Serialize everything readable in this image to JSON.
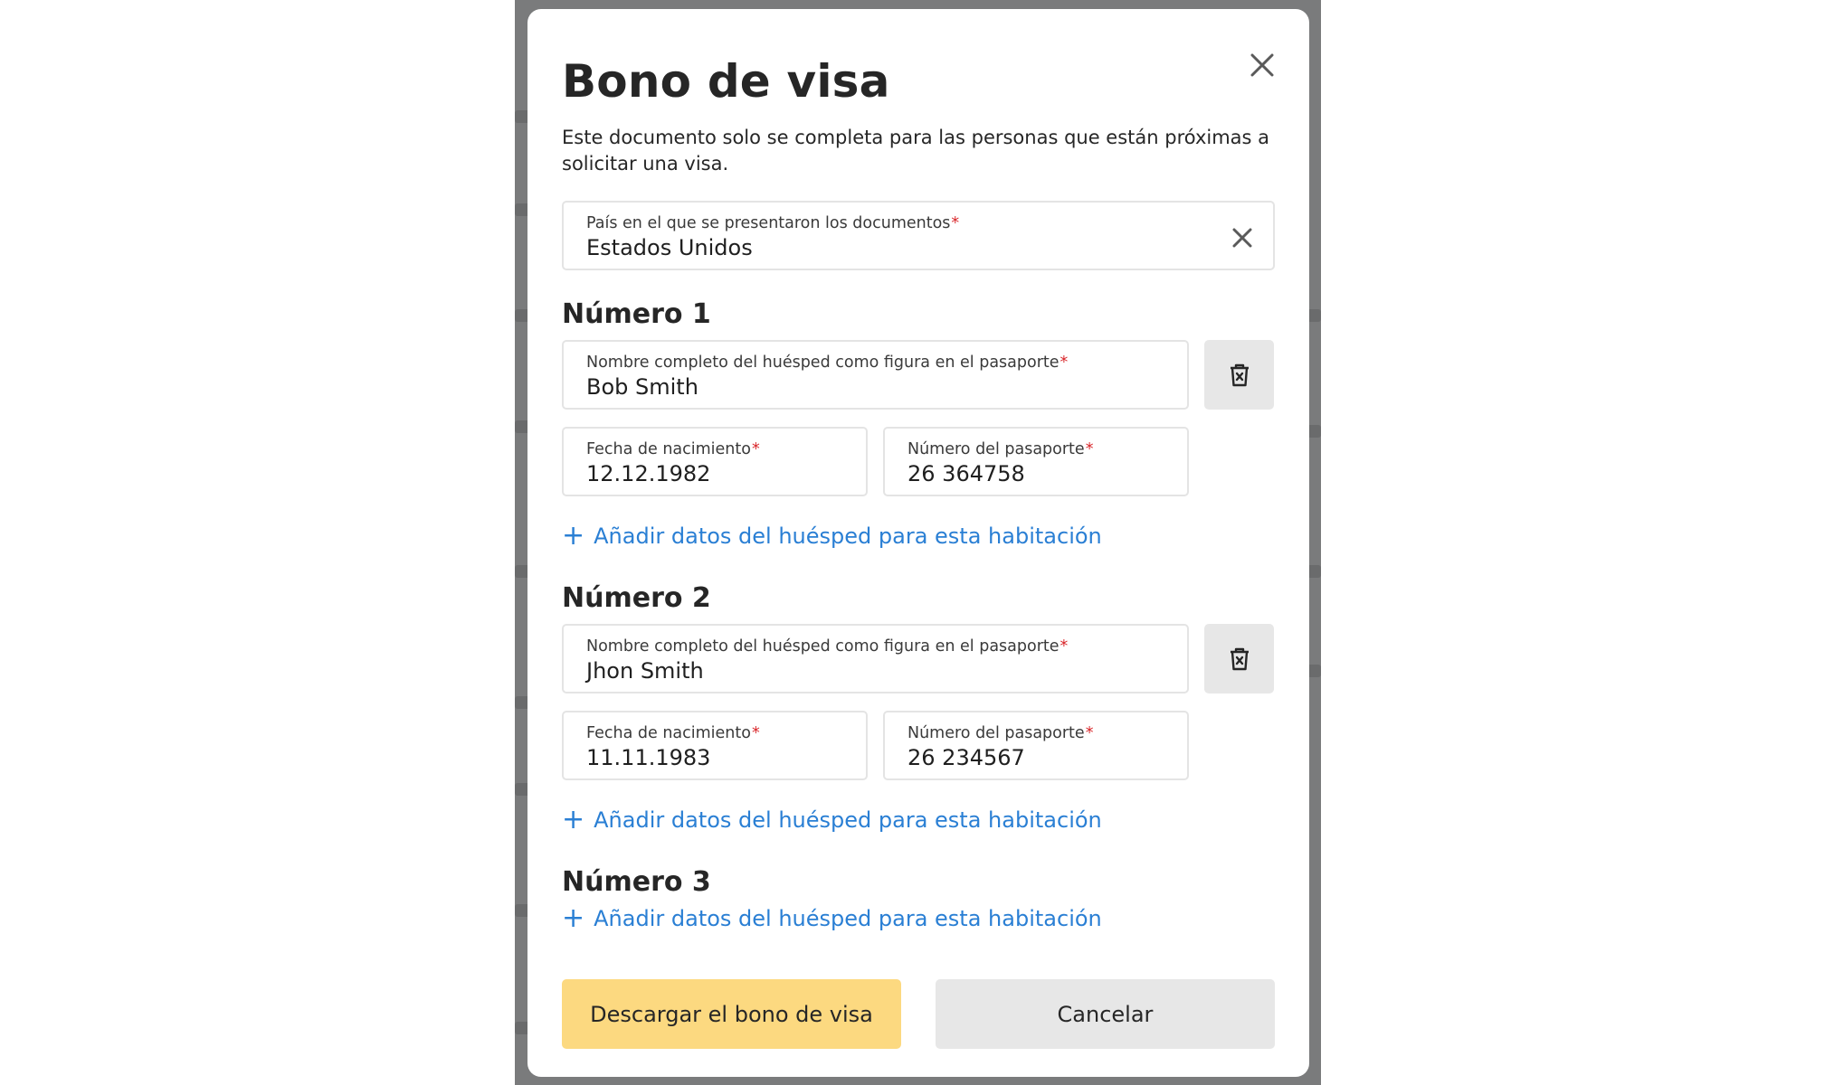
{
  "modal": {
    "title": "Bono de visa",
    "description": "Este documento solo se completa para las personas que están próximas a solicitar una visa.",
    "country_field": {
      "label": "País en el que se presentaron los documentos",
      "required_mark": "*",
      "value": "Estados Unidos"
    },
    "rooms": [
      {
        "title": "Número 1",
        "guest": {
          "name_label": "Nombre completo del huésped como figura en el pasaporte",
          "name_value": "Bob Smith",
          "dob_label": "Fecha de nacimiento",
          "dob_value": "12.12.1982",
          "passport_label": "Número del pasaporte",
          "passport_value": "26 364758"
        },
        "add_guest_label": "Añadir datos del huésped para esta habitación"
      },
      {
        "title": "Número 2",
        "guest": {
          "name_label": "Nombre completo del huésped como figura en el pasaporte",
          "name_value": "Jhon Smith",
          "dob_label": "Fecha de nacimiento",
          "dob_value": "11.11.1983",
          "passport_label": "Número del pasaporte",
          "passport_value": "26 234567"
        },
        "add_guest_label": "Añadir datos del huésped para esta habitación"
      },
      {
        "title": "Número 3",
        "add_guest_label": "Añadir datos del huésped para esta habitación"
      }
    ],
    "buttons": {
      "download_label": "Descargar el bono de visa",
      "cancel_label": "Cancelar"
    },
    "icons": {
      "close": "close-icon",
      "clear": "clear-icon",
      "delete": "trash-icon",
      "add": "plus-icon"
    },
    "colors": {
      "primary_button": "#fcd980",
      "secondary_button": "#e7e7e7",
      "link": "#2a7fd4",
      "required": "#d9262a",
      "overlay": "#7a7b7c"
    }
  }
}
